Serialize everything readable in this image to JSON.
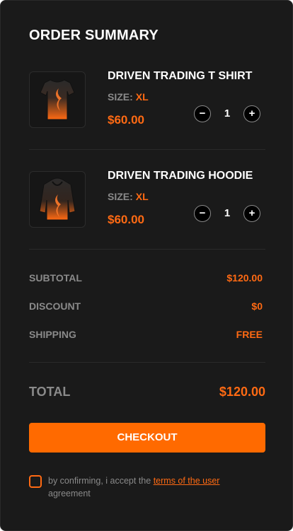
{
  "title": "ORDER SUMMARY",
  "items": [
    {
      "name": "DRIVEN TRADING T SHIRT",
      "size_label": "SIZE:",
      "size_value": "XL",
      "price": "$60.00",
      "quantity": "1",
      "decrement": "−",
      "increment": "+",
      "image_icon": "tshirt-icon"
    },
    {
      "name": "DRIVEN TRADING HOODIE",
      "size_label": "SIZE:",
      "size_value": "XL",
      "price": "$60.00",
      "quantity": "1",
      "decrement": "−",
      "increment": "+",
      "image_icon": "hoodie-icon"
    }
  ],
  "summary": {
    "subtotal_label": "SUBTOTAL",
    "subtotal_value": "$120.00",
    "discount_label": "DISCOUNT",
    "discount_value": "$0",
    "shipping_label": "SHIPPING",
    "shipping_value": "FREE"
  },
  "total": {
    "label": "TOTAL",
    "value": "$120.00"
  },
  "checkout_label": "CHECKOUT",
  "agreement": {
    "prefix": "by confirming, i accept the ",
    "link": "terms of the user",
    "suffix": " agreement"
  },
  "colors": {
    "background": "#1a1a1a",
    "accent": "#ff6a13",
    "muted": "#8a8a8a",
    "text": "#ffffff"
  }
}
